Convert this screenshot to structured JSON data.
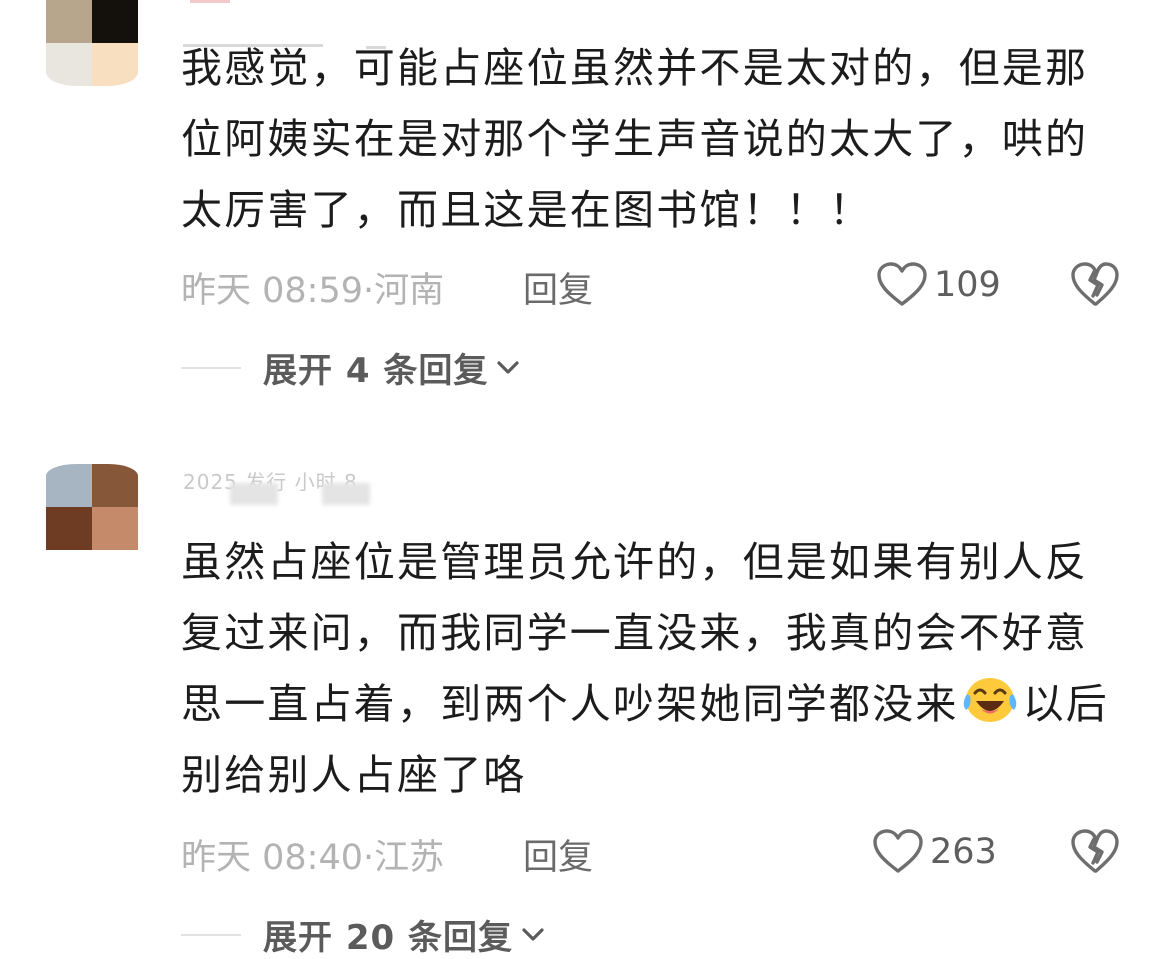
{
  "comments": [
    {
      "text": "我感觉，可能占座位虽然并不是太对的，但是那位阿姨实在是对那个学生声音说的太大了，哄的太厉害了，而且这是在图书馆！！！",
      "time": "昨天 08:59",
      "location": "河南",
      "reply_label": "回复",
      "likes": "109",
      "expand_label": "展开 4 条回复"
    },
    {
      "header": "2025 发行 小时 8",
      "text_part1": "虽然占座位是管理员允许的，但是如果有别人反复过来问，而我同学一直没来，我真的会不好意思一直占着，到两个人吵架她同学都没来",
      "emoji": "laughing-crying-emoji",
      "text_part2": "以后别给别人占座了咯",
      "time": "昨天 08:40",
      "location": "江苏",
      "reply_label": "回复",
      "likes": "263",
      "expand_label": "展开 20 条回复"
    }
  ],
  "separator": "·",
  "icons": {
    "like": "heart-outline-icon",
    "dislike": "broken-heart-icon",
    "expand": "chevron-down-icon"
  },
  "colors": {
    "text": "#1c1c1c",
    "meta": "#b3b3b3",
    "action": "#6a6a6a"
  }
}
